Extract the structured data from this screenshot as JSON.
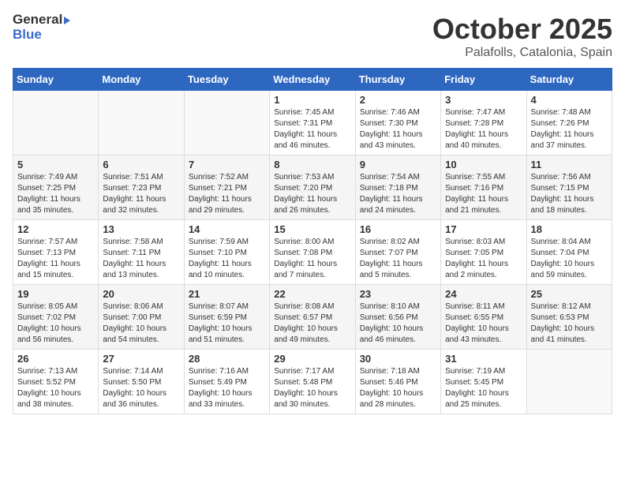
{
  "logo": {
    "general": "General",
    "blue": "Blue"
  },
  "header": {
    "month": "October 2025",
    "location": "Palafolls, Catalonia, Spain"
  },
  "weekdays": [
    "Sunday",
    "Monday",
    "Tuesday",
    "Wednesday",
    "Thursday",
    "Friday",
    "Saturday"
  ],
  "weeks": [
    [
      {
        "day": null,
        "sunrise": null,
        "sunset": null,
        "daylight": null
      },
      {
        "day": null,
        "sunrise": null,
        "sunset": null,
        "daylight": null
      },
      {
        "day": null,
        "sunrise": null,
        "sunset": null,
        "daylight": null
      },
      {
        "day": "1",
        "sunrise": "7:45 AM",
        "sunset": "7:31 PM",
        "daylight": "11 hours and 46 minutes."
      },
      {
        "day": "2",
        "sunrise": "7:46 AM",
        "sunset": "7:30 PM",
        "daylight": "11 hours and 43 minutes."
      },
      {
        "day": "3",
        "sunrise": "7:47 AM",
        "sunset": "7:28 PM",
        "daylight": "11 hours and 40 minutes."
      },
      {
        "day": "4",
        "sunrise": "7:48 AM",
        "sunset": "7:26 PM",
        "daylight": "11 hours and 37 minutes."
      }
    ],
    [
      {
        "day": "5",
        "sunrise": "7:49 AM",
        "sunset": "7:25 PM",
        "daylight": "11 hours and 35 minutes."
      },
      {
        "day": "6",
        "sunrise": "7:51 AM",
        "sunset": "7:23 PM",
        "daylight": "11 hours and 32 minutes."
      },
      {
        "day": "7",
        "sunrise": "7:52 AM",
        "sunset": "7:21 PM",
        "daylight": "11 hours and 29 minutes."
      },
      {
        "day": "8",
        "sunrise": "7:53 AM",
        "sunset": "7:20 PM",
        "daylight": "11 hours and 26 minutes."
      },
      {
        "day": "9",
        "sunrise": "7:54 AM",
        "sunset": "7:18 PM",
        "daylight": "11 hours and 24 minutes."
      },
      {
        "day": "10",
        "sunrise": "7:55 AM",
        "sunset": "7:16 PM",
        "daylight": "11 hours and 21 minutes."
      },
      {
        "day": "11",
        "sunrise": "7:56 AM",
        "sunset": "7:15 PM",
        "daylight": "11 hours and 18 minutes."
      }
    ],
    [
      {
        "day": "12",
        "sunrise": "7:57 AM",
        "sunset": "7:13 PM",
        "daylight": "11 hours and 15 minutes."
      },
      {
        "day": "13",
        "sunrise": "7:58 AM",
        "sunset": "7:11 PM",
        "daylight": "11 hours and 13 minutes."
      },
      {
        "day": "14",
        "sunrise": "7:59 AM",
        "sunset": "7:10 PM",
        "daylight": "11 hours and 10 minutes."
      },
      {
        "day": "15",
        "sunrise": "8:00 AM",
        "sunset": "7:08 PM",
        "daylight": "11 hours and 7 minutes."
      },
      {
        "day": "16",
        "sunrise": "8:02 AM",
        "sunset": "7:07 PM",
        "daylight": "11 hours and 5 minutes."
      },
      {
        "day": "17",
        "sunrise": "8:03 AM",
        "sunset": "7:05 PM",
        "daylight": "11 hours and 2 minutes."
      },
      {
        "day": "18",
        "sunrise": "8:04 AM",
        "sunset": "7:04 PM",
        "daylight": "10 hours and 59 minutes."
      }
    ],
    [
      {
        "day": "19",
        "sunrise": "8:05 AM",
        "sunset": "7:02 PM",
        "daylight": "10 hours and 56 minutes."
      },
      {
        "day": "20",
        "sunrise": "8:06 AM",
        "sunset": "7:00 PM",
        "daylight": "10 hours and 54 minutes."
      },
      {
        "day": "21",
        "sunrise": "8:07 AM",
        "sunset": "6:59 PM",
        "daylight": "10 hours and 51 minutes."
      },
      {
        "day": "22",
        "sunrise": "8:08 AM",
        "sunset": "6:57 PM",
        "daylight": "10 hours and 49 minutes."
      },
      {
        "day": "23",
        "sunrise": "8:10 AM",
        "sunset": "6:56 PM",
        "daylight": "10 hours and 46 minutes."
      },
      {
        "day": "24",
        "sunrise": "8:11 AM",
        "sunset": "6:55 PM",
        "daylight": "10 hours and 43 minutes."
      },
      {
        "day": "25",
        "sunrise": "8:12 AM",
        "sunset": "6:53 PM",
        "daylight": "10 hours and 41 minutes."
      }
    ],
    [
      {
        "day": "26",
        "sunrise": "7:13 AM",
        "sunset": "5:52 PM",
        "daylight": "10 hours and 38 minutes."
      },
      {
        "day": "27",
        "sunrise": "7:14 AM",
        "sunset": "5:50 PM",
        "daylight": "10 hours and 36 minutes."
      },
      {
        "day": "28",
        "sunrise": "7:16 AM",
        "sunset": "5:49 PM",
        "daylight": "10 hours and 33 minutes."
      },
      {
        "day": "29",
        "sunrise": "7:17 AM",
        "sunset": "5:48 PM",
        "daylight": "10 hours and 30 minutes."
      },
      {
        "day": "30",
        "sunrise": "7:18 AM",
        "sunset": "5:46 PM",
        "daylight": "10 hours and 28 minutes."
      },
      {
        "day": "31",
        "sunrise": "7:19 AM",
        "sunset": "5:45 PM",
        "daylight": "10 hours and 25 minutes."
      },
      {
        "day": null,
        "sunrise": null,
        "sunset": null,
        "daylight": null
      }
    ]
  ]
}
